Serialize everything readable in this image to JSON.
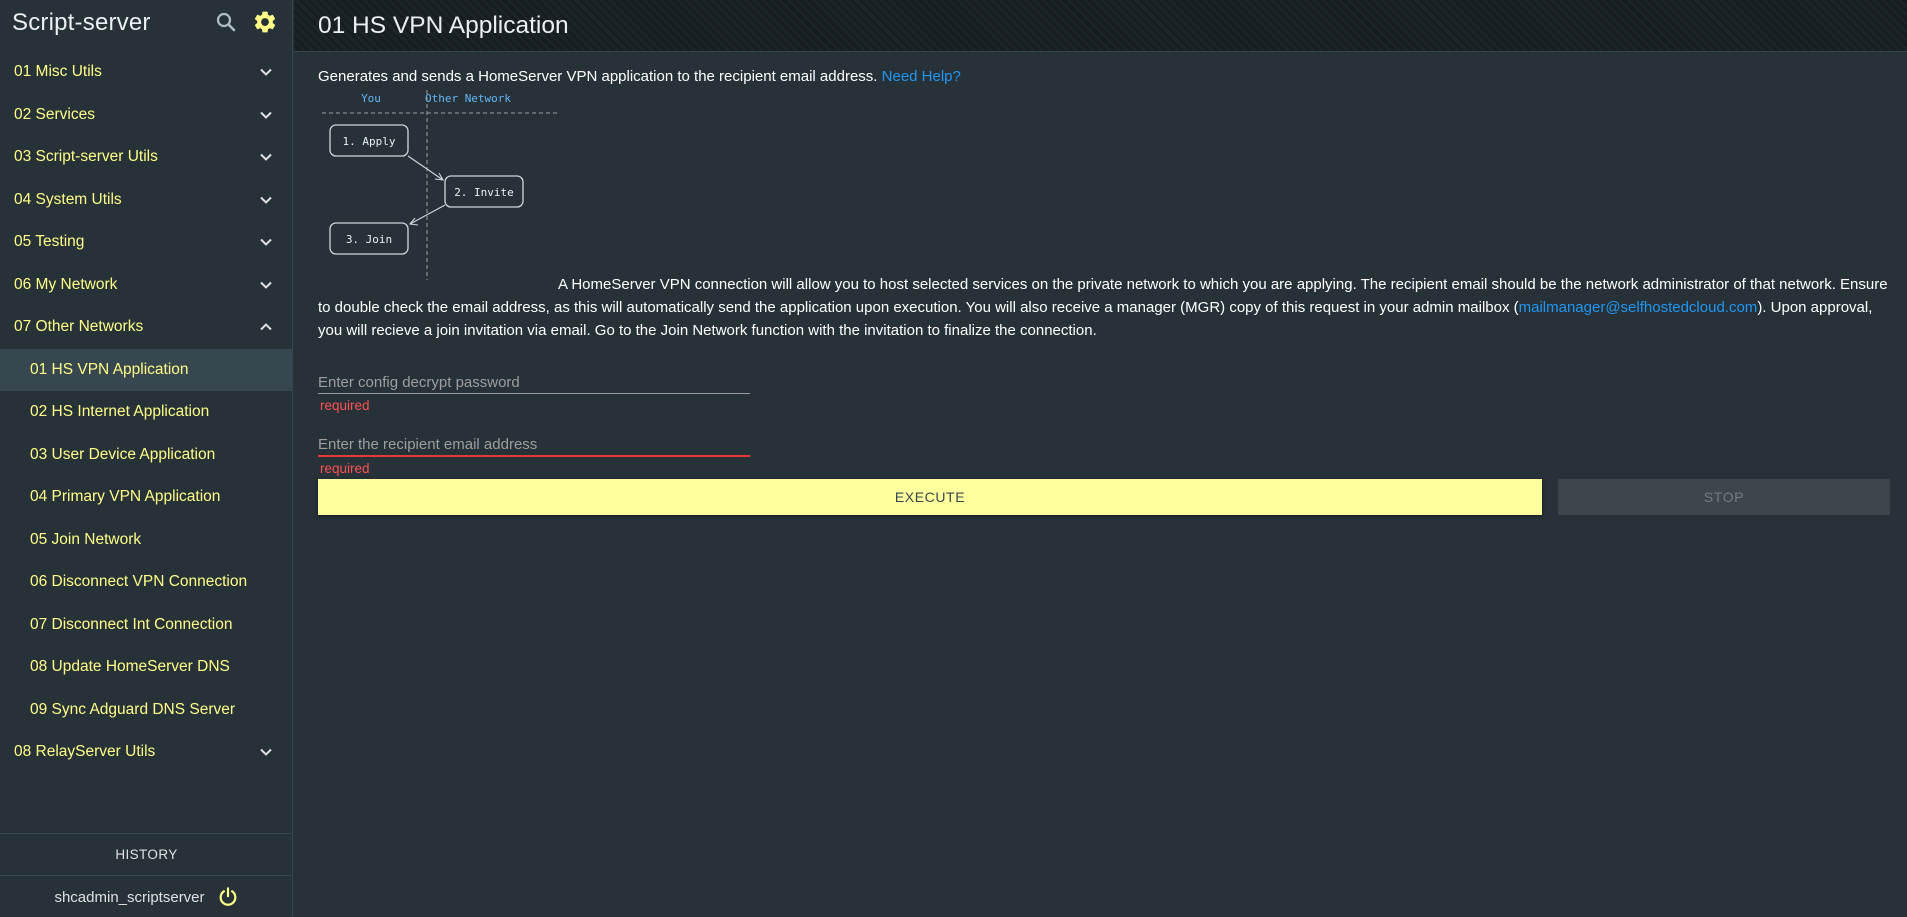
{
  "app": {
    "title": "Script-server"
  },
  "sidebar": {
    "groups": [
      {
        "label": "01 Misc Utils"
      },
      {
        "label": "02 Services"
      },
      {
        "label": "03 Script-server Utils"
      },
      {
        "label": "04 System Utils"
      },
      {
        "label": "05 Testing"
      },
      {
        "label": "06 My Network"
      },
      {
        "label": "07 Other Networks"
      },
      {
        "label": "08 RelayServer Utils"
      }
    ],
    "expanded_group_items": [
      {
        "label": "01 HS VPN Application"
      },
      {
        "label": "02 HS Internet Application"
      },
      {
        "label": "03 User Device Application"
      },
      {
        "label": "04 Primary VPN Application"
      },
      {
        "label": "05 Join Network"
      },
      {
        "label": "06 Disconnect VPN Connection"
      },
      {
        "label": "07 Disconnect Int Connection"
      },
      {
        "label": "08 Update HomeServer DNS"
      },
      {
        "label": "09 Sync Adguard DNS Server"
      }
    ],
    "history_label": "HISTORY",
    "username": "shcadmin_scriptserver"
  },
  "header": {
    "title": "01 HS VPN Application"
  },
  "main": {
    "intro": "Generates and sends a HomeServer VPN application to the recipient email address.",
    "help_link": "Need Help?",
    "diagram": {
      "col_you": "You",
      "col_other": "Other Network",
      "step1": "1. Apply",
      "step2": "2. Invite",
      "step3": "3. Join"
    },
    "para_part1": "A HomeServer VPN connection will allow you to host selected services on the private network to which you are applying. The recipient email should be the network administrator of that network. Ensure to double check the email address, as this will automatically send the application upon execution. You will also receive a manager (MGR) copy of this request in your admin mailbox (",
    "para_email": "mailmanager@selfhostedcloud.com",
    "para_part2": "). Upon approval, you will recieve a join invitation via email. Go to the Join Network function with the invitation to finalize the connection.",
    "password_placeholder": "Enter config decrypt password",
    "password_error": "required",
    "email_placeholder": "Enter the recipient email address",
    "email_error": "required",
    "execute_label": "EXECUTE",
    "stop_label": "STOP"
  },
  "colors": {
    "background": "#263238",
    "accent_text": "#fffd87",
    "link": "#2196f3",
    "execute_button": "#ffff9d",
    "error": "#ff5252"
  }
}
